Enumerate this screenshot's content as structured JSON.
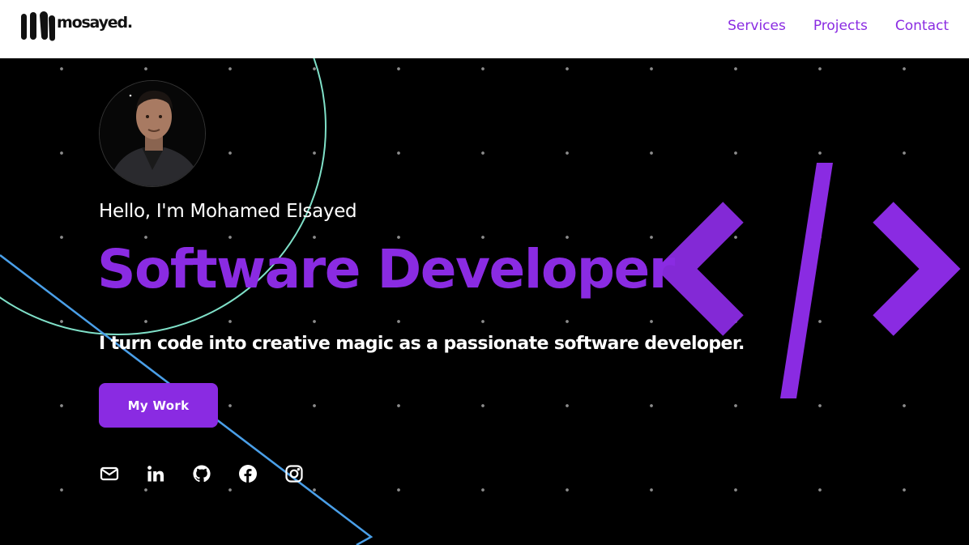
{
  "brand": {
    "name": "mosayed."
  },
  "nav": {
    "items": [
      {
        "label": "Services"
      },
      {
        "label": "Projects"
      },
      {
        "label": "Contact"
      }
    ]
  },
  "hero": {
    "greeting": "Hello, I'm Mohamed Elsayed",
    "title": "Software Developer",
    "tagline": "I turn code into creative magic as a passionate software developer.",
    "cta_label": "My Work",
    "decor_icon": "code-brackets-icon"
  },
  "socials": [
    {
      "icon": "mail-icon"
    },
    {
      "icon": "linkedin-icon"
    },
    {
      "icon": "github-icon"
    },
    {
      "icon": "facebook-icon"
    },
    {
      "icon": "instagram-icon"
    }
  ],
  "colors": {
    "accent": "#8a2be2",
    "background": "#000000",
    "navbar": "#ffffff",
    "dot_grid": "#8c8c8c",
    "circle_outline": "#7fe0c8",
    "triangle_outline": "#4a9fe8"
  }
}
